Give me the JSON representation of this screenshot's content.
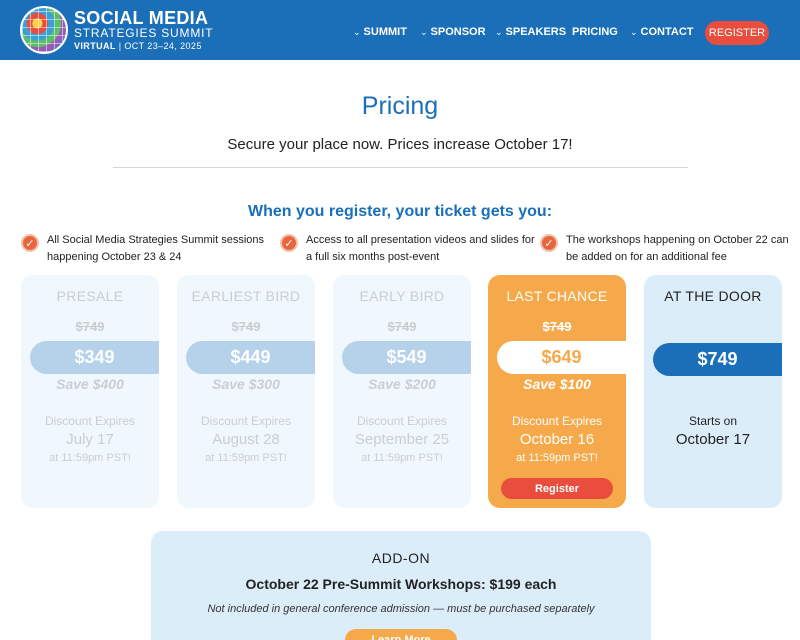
{
  "header": {
    "logo_title": "SOCIAL MEDIA",
    "logo_subtitle": "STRATEGIES SUMMIT",
    "logo_virtual": "VIRTUAL",
    "logo_dates": "| OCT 23–24, 2025",
    "nav": [
      {
        "label": "SUMMIT",
        "has_dropdown": true
      },
      {
        "label": "SPONSOR",
        "has_dropdown": true
      },
      {
        "label": "SPEAKERS",
        "has_dropdown": true
      },
      {
        "label": "PRICING",
        "has_dropdown": false
      },
      {
        "label": "CONTACT",
        "has_dropdown": true
      }
    ],
    "register_label": "REGISTER",
    "colors": {
      "bar": "#1a6fb8",
      "register": "#e84d3d"
    }
  },
  "page": {
    "title": "Pricing",
    "subtitle": "Secure your place now. Prices increase October 17!",
    "benefits_title": "When you register, your ticket gets you:",
    "benefits": [
      "All Social Media Strategies Summit sessions happening October 23 & 24",
      "Access to all presentation videos and slides for a full six months post-event",
      "The workshops happening on October 22 can be added on for an additional fee"
    ]
  },
  "cards": [
    {
      "tier": "PRESALE",
      "old_price": "$749",
      "price": "$349",
      "save": "Save $400",
      "expires_label": "Discount Expires",
      "expires_date": "July 17",
      "expires_time": "at 11:59pm PST!",
      "state": "expired"
    },
    {
      "tier": "EARLIEST BIRD",
      "old_price": "$749",
      "price": "$449",
      "save": "Save $300",
      "expires_label": "Discount Expires",
      "expires_date": "August 28",
      "expires_time": "at 11:59pm PST!",
      "state": "expired"
    },
    {
      "tier": "EARLY BIRD",
      "old_price": "$749",
      "price": "$549",
      "save": "Save $200",
      "expires_label": "Discount Expires",
      "expires_date": "September 25",
      "expires_time": "at 11:59pm PST!",
      "state": "expired"
    },
    {
      "tier": "LAST CHANCE",
      "old_price": "$749",
      "price": "$649",
      "save": "Save $100",
      "expires_label": "Discount Expires",
      "expires_date": "October 16",
      "expires_time": "at 11:59pm PST!",
      "state": "active",
      "button": "Register"
    },
    {
      "tier": "AT THE DOOR",
      "price": "$749",
      "starts_label": "Starts on",
      "starts_date": "October 17",
      "state": "upcoming"
    }
  ],
  "addon": {
    "label": "ADD-ON",
    "title": "October 22 Pre-Summit Workshops: $199 each",
    "note": "Not included in general conference admission — must be purchased separately",
    "button": "Learn More"
  }
}
